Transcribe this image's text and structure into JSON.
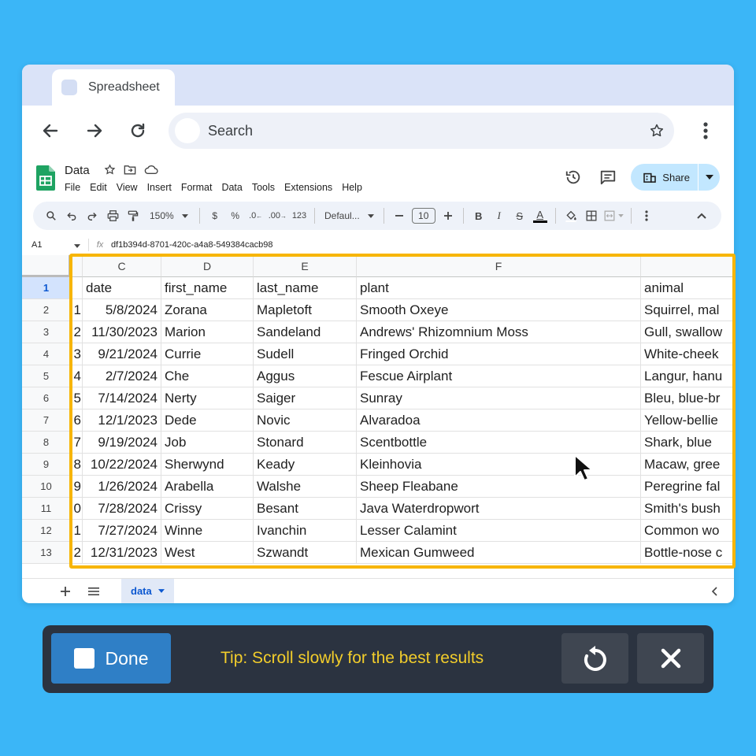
{
  "browser": {
    "tab_title": "Spreadsheet",
    "search_placeholder": "Search"
  },
  "sheets": {
    "doc_title": "Data",
    "menu": [
      "File",
      "Edit",
      "View",
      "Insert",
      "Format",
      "Data",
      "Tools",
      "Extensions",
      "Help"
    ],
    "share_label": "Share",
    "toolbar": {
      "zoom": "150%",
      "currency": "$",
      "percent": "%",
      "dec_decrease": ".0←",
      "dec_increase": ".00",
      "number_format": "123",
      "font": "Defaul...",
      "font_size": "10",
      "bold": "B",
      "italic": "I",
      "strike": "S",
      "text_color": "A"
    },
    "name_box": "A1",
    "formula_value": "df1b394d-8701-420c-a4a8-549384cacb98",
    "columns": [
      {
        "letter": "",
        "key": "b"
      },
      {
        "letter": "C",
        "key": "c"
      },
      {
        "letter": "D",
        "key": "d"
      },
      {
        "letter": "E",
        "key": "e"
      },
      {
        "letter": "F",
        "key": "f"
      },
      {
        "letter": "",
        "key": "g"
      }
    ],
    "rows": [
      {
        "num": "1",
        "b": "",
        "c": "date",
        "d": "first_name",
        "e": "last_name",
        "f": "plant",
        "g": "animal"
      },
      {
        "num": "2",
        "b": "1",
        "c": "5/8/2024",
        "d": "Zorana",
        "e": "Mapletoft",
        "f": "Smooth Oxeye",
        "g": "Squirrel, mal"
      },
      {
        "num": "3",
        "b": "2",
        "c": "11/30/2023",
        "d": "Marion",
        "e": "Sandeland",
        "f": "Andrews' Rhizomnium Moss",
        "g": "Gull, swallow"
      },
      {
        "num": "4",
        "b": "3",
        "c": "9/21/2024",
        "d": "Currie",
        "e": "Sudell",
        "f": "Fringed Orchid",
        "g": "White-cheek"
      },
      {
        "num": "5",
        "b": "4",
        "c": "2/7/2024",
        "d": "Che",
        "e": "Aggus",
        "f": "Fescue Airplant",
        "g": "Langur, hanu"
      },
      {
        "num": "6",
        "b": "5",
        "c": "7/14/2024",
        "d": "Nerty",
        "e": "Saiger",
        "f": "Sunray",
        "g": "Bleu, blue-br"
      },
      {
        "num": "7",
        "b": "6",
        "c": "12/1/2023",
        "d": "Dede",
        "e": "Novic",
        "f": "Alvaradoa",
        "g": "Yellow-bellie"
      },
      {
        "num": "8",
        "b": "7",
        "c": "9/19/2024",
        "d": "Job",
        "e": "Stonard",
        "f": "Scentbottle",
        "g": "Shark, blue"
      },
      {
        "num": "9",
        "b": "8",
        "c": "10/22/2024",
        "d": "Sherwynd",
        "e": "Keady",
        "f": "Kleinhovia",
        "g": "Macaw, gree"
      },
      {
        "num": "10",
        "b": "9",
        "c": "1/26/2024",
        "d": "Arabella",
        "e": "Walshe",
        "f": "Sheep Fleabane",
        "g": "Peregrine fal"
      },
      {
        "num": "11",
        "b": "0",
        "c": "7/28/2024",
        "d": "Crissy",
        "e": "Besant",
        "f": "Java Waterdropwort",
        "g": "Smith's bush"
      },
      {
        "num": "12",
        "b": "1",
        "c": "7/27/2024",
        "d": "Winne",
        "e": "Ivanchin",
        "f": "Lesser Calamint",
        "g": "Common wo"
      },
      {
        "num": "13",
        "b": "2",
        "c": "12/31/2023",
        "d": "West",
        "e": "Szwandt",
        "f": "Mexican Gumweed",
        "g": "Bottle-nose c"
      }
    ],
    "sheet_tab": "data"
  },
  "recorder": {
    "done_label": "Done",
    "tip": "Tip: Scroll slowly for the best results"
  },
  "colors": {
    "background": "#3bb6f7",
    "highlight": "#f7b500",
    "tip_text": "#f2cd2b",
    "done_button": "#2f7fc6",
    "share_button": "#c2e7ff"
  }
}
